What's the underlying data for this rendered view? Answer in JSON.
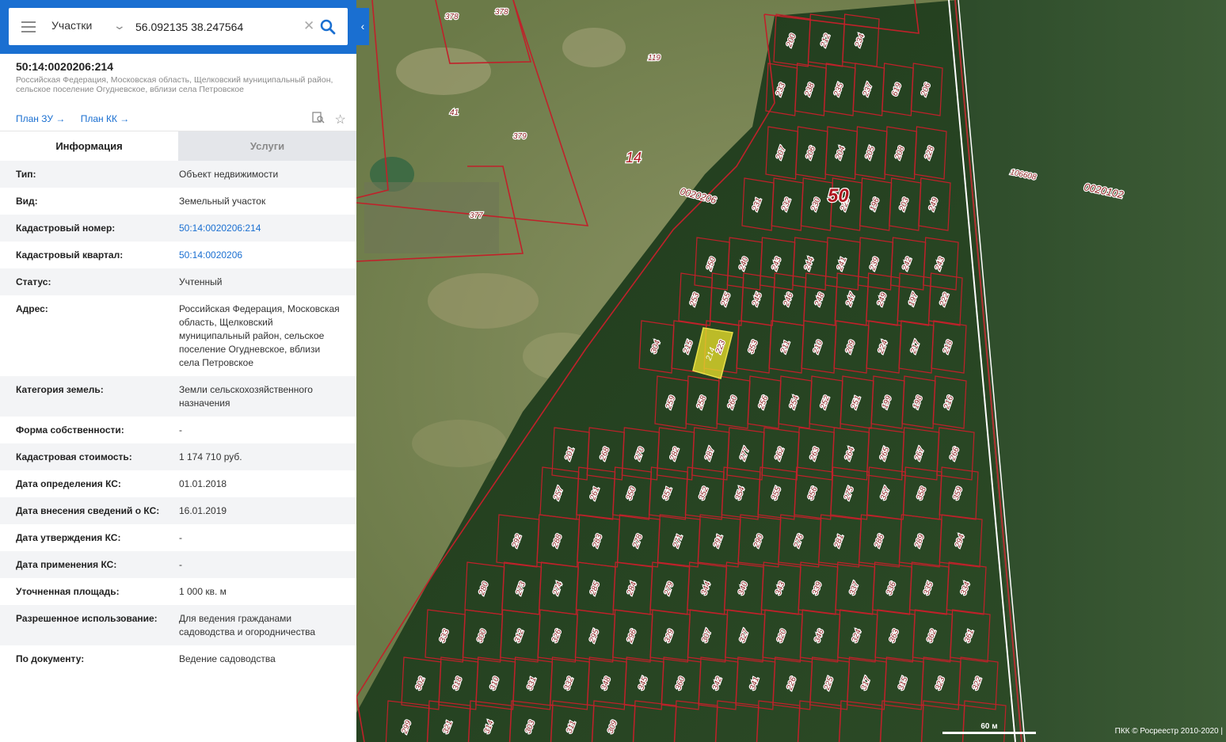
{
  "search": {
    "layer": "Участки",
    "query": "56.092135 38.247564"
  },
  "object": {
    "number": "50:14:0020206:214",
    "address": "Российская Федерация, Московская область, Щелковский муниципальный район, сельское поселение Огудневское, вблизи села Петровское",
    "plan_zu": "План ЗУ →",
    "plan_kk": "План КК →"
  },
  "tabs": {
    "info": "Информация",
    "services": "Услуги"
  },
  "properties": [
    {
      "key": "Тип:",
      "value": "Объект недвижимости"
    },
    {
      "key": "Вид:",
      "value": "Земельный участок"
    },
    {
      "key": "Кадастровый номер:",
      "value": "50:14:0020206:214"
    },
    {
      "key": "Кадастровый квартал:",
      "value": "50:14:0020206"
    },
    {
      "key": "Статус:",
      "value": "Учтенный"
    },
    {
      "key": "Адрес:",
      "value": "Российская Федерация, Московская область, Щелковский муниципальный район, сельское поселение Огудневское, вблизи села Петровское"
    },
    {
      "key": "Категория земель:",
      "value": "Земли сельскохозяйственного назначения"
    },
    {
      "key": "Форма собственности:",
      "value": "-"
    },
    {
      "key": "Кадастровая стоимость:",
      "value": "1 174 710 руб."
    },
    {
      "key": "Дата определения КС:",
      "value": "01.01.2018"
    },
    {
      "key": "Дата внесения сведений о КС:",
      "value": "16.01.2019"
    },
    {
      "key": "Дата утверждения КС:",
      "value": "-"
    },
    {
      "key": "Дата применения КС:",
      "value": "-"
    },
    {
      "key": "Уточненная площадь:",
      "value": "1 000 кв. м"
    },
    {
      "key": "Разрешенное использование:",
      "value": "Для ведения гражданами садоводства и огородничества"
    },
    {
      "key": "По документу:",
      "value": "Ведение садоводства"
    }
  ],
  "map": {
    "labels": {
      "district": "50",
      "zone": "14",
      "quarter_main": "0020206",
      "quarter_east": "0020102",
      "parcel_east": "106608",
      "selected": "214"
    },
    "parcels": [
      "378",
      "378",
      "119",
      "41",
      "379",
      "377",
      "200",
      "212",
      "234",
      "233",
      "238",
      "235",
      "237",
      "619",
      "206",
      "207",
      "206",
      "204",
      "205",
      "208",
      "228",
      "231",
      "232",
      "230",
      "229",
      "196",
      "203",
      "249",
      "250",
      "240",
      "243",
      "244",
      "241",
      "239",
      "242",
      "243",
      "253",
      "255",
      "245",
      "246",
      "248",
      "247",
      "249",
      "197",
      "222",
      "304",
      "215",
      "223",
      "353",
      "211",
      "210",
      "209",
      "224",
      "217",
      "218",
      "259",
      "258",
      "260",
      "256",
      "254",
      "252",
      "251",
      "199",
      "198",
      "216",
      "201",
      "268",
      "270",
      "282",
      "287",
      "277",
      "262",
      "263",
      "264",
      "265",
      "267",
      "266",
      "257",
      "261",
      "350",
      "351",
      "352",
      "354",
      "355",
      "356",
      "275",
      "357",
      "358",
      "359",
      "292",
      "288",
      "283",
      "278",
      "271",
      "291",
      "290",
      "276",
      "281",
      "286",
      "289",
      "294",
      "280",
      "273",
      "274",
      "285",
      "284",
      "279",
      "344",
      "340",
      "343",
      "339",
      "337",
      "336",
      "335",
      "334",
      "333",
      "300",
      "312",
      "326",
      "295",
      "296",
      "329",
      "307",
      "327",
      "320",
      "346",
      "324",
      "363",
      "362",
      "361",
      "302",
      "318",
      "310",
      "331",
      "332",
      "348",
      "345",
      "360",
      "342",
      "341",
      "226",
      "225",
      "317",
      "315",
      "323",
      "322",
      "299",
      "321",
      "314",
      "303",
      "311",
      "309"
    ],
    "scale": "60 м",
    "attribution": "ПКК © Росреестр 2010-2020 |"
  }
}
